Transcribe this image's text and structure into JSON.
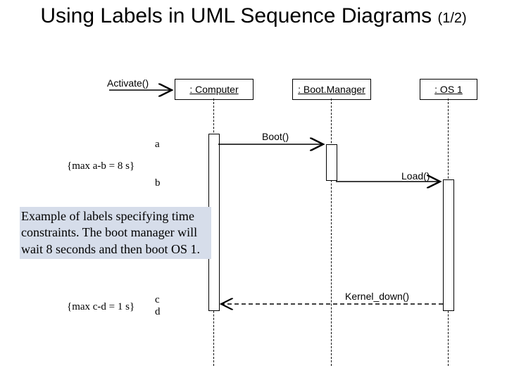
{
  "title_main": "Using Labels in UML Sequence Diagrams",
  "title_sub": "(1/2)",
  "activate": "Activate()",
  "participants": {
    "computer": ": Computer",
    "bootmgr": ": Boot.Manager",
    "os1": ": OS 1"
  },
  "messages": {
    "boot": "Boot()",
    "load": "Load()",
    "kernel_down": "Kernel_down()"
  },
  "time_labels": {
    "a": "a",
    "b": "b",
    "c": "c",
    "d": "d"
  },
  "constraints": {
    "ab": "{max a-b = 8 s}",
    "cd": "{max c-d = 1 s}"
  },
  "caption": "Example of labels specifying time constraints. The boot manager will wait 8 seconds and then boot OS 1.",
  "chart_data": {
    "type": "sequence_diagram",
    "participants": [
      "Computer",
      "Boot.Manager",
      "OS 1"
    ],
    "messages": [
      {
        "from": "external",
        "to": "Computer",
        "name": "Activate()",
        "time": "start"
      },
      {
        "from": "Computer",
        "to": "Boot.Manager",
        "name": "Boot()",
        "time": "a"
      },
      {
        "from": "Boot.Manager",
        "to": "OS 1",
        "name": "Load()",
        "time": "b"
      },
      {
        "from": "OS 1",
        "to": "Computer",
        "name": "Kernel_down()",
        "time": "c-d",
        "return": true
      }
    ],
    "constraints": [
      {
        "between": [
          "a",
          "b"
        ],
        "max_seconds": 8
      },
      {
        "between": [
          "c",
          "d"
        ],
        "max_seconds": 1
      }
    ]
  }
}
